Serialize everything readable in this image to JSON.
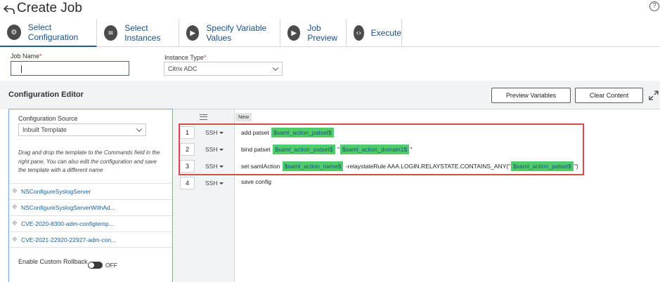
{
  "header": {
    "title": "Create Job",
    "help_glyph": "?"
  },
  "tabs": [
    {
      "label": "Select Configuration",
      "icon": "gear-icon",
      "active": true
    },
    {
      "label": "Select Instances",
      "icon": "server-icon",
      "active": false
    },
    {
      "label": "Specify Variable Values",
      "icon": "play-icon",
      "active": false
    },
    {
      "label": "Job Preview",
      "icon": "play-icon",
      "active": false
    },
    {
      "label": "Execute",
      "icon": "code-icon",
      "active": false
    }
  ],
  "form": {
    "job_name_label": "Job Name",
    "job_name_value": "",
    "instance_type_label": "Instance Type",
    "instance_type_value": "Citrix ADC",
    "required_mark": "*"
  },
  "editor": {
    "title": "Configuration Editor",
    "preview_button": "Preview Variables",
    "clear_button": "Clear Content",
    "config_source_label": "Configuration Source",
    "config_source_value": "Inbuilt Template",
    "help_text": "Drag and drop the template to the Commands field in the right pane. You can also edit the configuration and save the template with a different name",
    "templates": [
      "NSConfigureSyslogServer",
      "NSConfigureSyslogServerWithAd...",
      "CVE-2020-8300-adm-configtemp...",
      "CVE-2021-22920-22927-adm-con..."
    ],
    "rollback_label": "Enable Custom Rollback",
    "rollback_state": "OFF",
    "new_badge": "New",
    "rows": [
      {
        "num": "1",
        "protocol": "SSH"
      },
      {
        "num": "2",
        "protocol": "SSH"
      },
      {
        "num": "3",
        "protocol": "SSH"
      },
      {
        "num": "4",
        "protocol": "SSH"
      }
    ],
    "commands": {
      "c1_text": "add patset ",
      "c1_var": "$saml_action_patset$",
      "c2_text": "bind patset ",
      "c2_var1": "$saml_action_patset$",
      "c2_quote1": " \"",
      "c2_var2": "$saml_action_domain1$",
      "c2_quote2": "\"",
      "c3_text": "set samlAction ",
      "c3_var1": "$saml_action_name$",
      "c3_mid": " -relaystateRule AAA.LOGIN.RELAYSTATE.CONTAINS_ANY(\"",
      "c3_var2": "$saml_action_patset$",
      "c3_end": "\")",
      "c4_text": "save config"
    }
  },
  "colors": {
    "accent": "#1a5f9a",
    "highlight": "#52cc6a",
    "callout": "#d64c4c"
  }
}
